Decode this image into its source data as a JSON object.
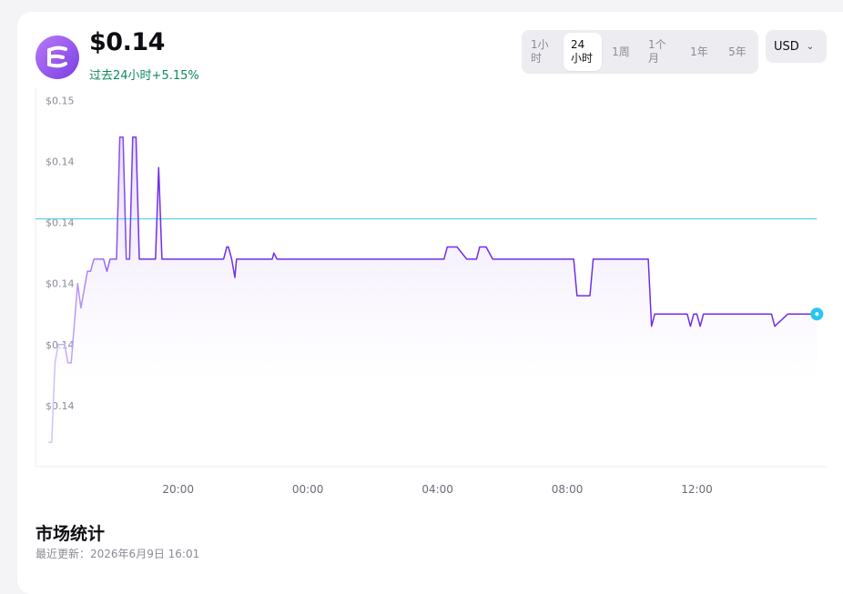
{
  "header": {
    "price": "$0.14",
    "change_period": "过去24小时",
    "change_value": "+5.15%"
  },
  "ranges": [
    {
      "label": "1小时",
      "active": false
    },
    {
      "label": "24小时",
      "active": true
    },
    {
      "label": "1周",
      "active": false
    },
    {
      "label": "1个月",
      "active": false
    },
    {
      "label": "1年",
      "active": false
    },
    {
      "label": "5年",
      "active": false
    }
  ],
  "currency": {
    "label": "USD",
    "icon": "chevron-down-icon"
  },
  "stats": {
    "title": "市场统计",
    "updated_label": "最近更新：",
    "updated_value": "2026年6月9日 16:01"
  },
  "colors": {
    "line": "#6f2fe8",
    "line_light": "#cdb8f6",
    "reference_line": "#3cc6e8",
    "fill": "#efe7fd",
    "brand": "#8b4ef0",
    "positive": "#0d8a5a"
  },
  "chart_data": {
    "type": "line",
    "x_tick_labels": [
      "20:00",
      "00:00",
      "04:00",
      "08:00",
      "12:00"
    ],
    "x_ticks_hours": [
      20,
      24,
      28,
      32,
      36
    ],
    "y_tick_labels": [
      "$0.15",
      "$0.14",
      "$0.14",
      "$0.14",
      "$0.14",
      "$0.14"
    ],
    "y_ticks_values": [
      0.1435,
      0.1425,
      0.1415,
      0.1405,
      0.1395,
      0.1385
    ],
    "ylim": [
      0.1375,
      0.1437
    ],
    "xlim": [
      15.6,
      40
    ],
    "reference_value": 0.14156,
    "last_value": 0.14156,
    "grid": false,
    "legend": "none",
    "series": [
      {
        "hours": [
          16,
          16.1,
          16.2,
          16.3,
          16.5,
          16.6,
          16.7,
          16.9,
          17.0,
          17.2,
          17.3,
          17.4,
          17.6,
          17.7,
          17.8,
          17.9,
          18.0,
          18.1,
          18.2,
          18.3,
          18.4,
          18.5,
          18.6,
          18.7,
          18.8,
          18.9,
          19.0,
          19.1,
          19.2,
          19.3,
          19.4,
          19.5,
          19.7,
          19.9,
          20.1,
          20.15,
          20.25,
          20.35,
          20.45,
          20.6,
          21.0,
          21.4,
          21.5,
          21.55,
          21.65,
          21.75,
          21.8,
          21.85,
          21.95,
          22.05,
          22.1,
          22.2,
          22.35,
          22.8,
          22.9,
          22.95,
          23.05,
          23.15,
          23.3,
          23.5,
          23.55,
          23.65,
          23.8,
          23.9,
          24.1,
          24.2,
          24.3,
          24.4,
          24.5,
          24.6,
          24.8,
          25.2,
          25.3,
          25.35,
          25.45,
          25.55,
          25.65,
          25.75,
          25.85,
          25.9,
          26.0,
          26.1,
          26.2,
          26.3,
          26.6,
          26.65,
          26.75,
          27.0,
          27.05,
          27.15,
          27.3,
          27.8,
          27.9,
          28.2,
          28.3,
          28.6,
          28.9,
          29.0,
          29.2,
          29.3,
          29.5,
          29.7,
          31.4,
          31.5,
          31.55,
          31.65,
          31.75,
          31.85,
          31.9,
          32.0,
          32.1,
          32.2,
          32.3,
          32.4,
          32.5,
          32.6,
          32.7,
          32.8,
          32.9,
          33.0,
          33.1,
          33.2,
          33.3,
          33.4,
          33.6,
          33.7,
          33.8,
          34.0,
          34.3,
          34.5,
          34.6,
          34.7,
          35.5,
          35.6,
          35.7,
          35.8,
          35.9,
          36.0,
          36.1,
          36.2,
          36.3,
          36.4,
          36.5,
          36.8,
          36.9,
          37.0,
          37.2,
          37.3,
          37.5,
          37.8,
          37.9,
          38.0,
          38.1,
          38.2,
          38.3,
          38.4,
          38.8,
          39.4,
          39.7
        ],
        "values": [
          0.1379,
          0.1379,
          0.1392,
          0.1395,
          0.1395,
          0.1392,
          0.1392,
          0.1405,
          0.1401,
          0.1407,
          0.1407,
          0.1409,
          0.1409,
          0.1409,
          0.1407,
          0.1409,
          0.1409,
          0.1409,
          0.1429,
          0.1429,
          0.1409,
          0.1409,
          0.1429,
          0.1429,
          0.1409,
          0.1409,
          0.1409,
          0.1409,
          0.1409,
          0.1409,
          0.1424,
          0.1409,
          0.1409,
          0.1409,
          0.1409,
          0.1409,
          0.1409,
          0.1409,
          0.1409,
          0.1409,
          0.1409,
          0.1409,
          0.1411,
          0.1411,
          0.1409,
          0.1406,
          0.1409,
          0.1409,
          0.1409,
          0.1409,
          0.1409,
          0.1409,
          0.1409,
          0.1409,
          0.1409,
          0.141,
          0.1409,
          0.1409,
          0.1409,
          0.1409,
          0.1409,
          0.1409,
          0.1409,
          0.1409,
          0.1409,
          0.1409,
          0.1409,
          0.1409,
          0.1409,
          0.1409,
          0.1409,
          0.1409,
          0.1409,
          0.1409,
          0.1409,
          0.1409,
          0.1409,
          0.1409,
          0.1409,
          0.1409,
          0.1409,
          0.1409,
          0.1409,
          0.1409,
          0.1409,
          0.1409,
          0.1409,
          0.1409,
          0.1409,
          0.1409,
          0.1409,
          0.1409,
          0.1409,
          0.1409,
          0.1411,
          0.1411,
          0.1409,
          0.1409,
          0.1409,
          0.1411,
          0.1411,
          0.1409,
          0.1409,
          0.1409,
          0.1409,
          0.1409,
          0.1409,
          0.1409,
          0.1409,
          0.1409,
          0.1409,
          0.1409,
          0.1403,
          0.1403,
          0.1403,
          0.1403,
          0.1403,
          0.1409,
          0.1409,
          0.1409,
          0.1409,
          0.1409,
          0.1409,
          0.1409,
          0.1409,
          0.1409,
          0.1409,
          0.1409,
          0.1409,
          0.1409,
          0.1398,
          0.14,
          0.14,
          0.14,
          0.14,
          0.1398,
          0.14,
          0.14,
          0.1398,
          0.14,
          0.14,
          0.14,
          0.14,
          0.14,
          0.14,
          0.14,
          0.14,
          0.14,
          0.14,
          0.14,
          0.14,
          0.14,
          0.14,
          0.14,
          0.14,
          0.1398,
          0.14,
          0.14,
          0.14
        ]
      }
    ]
  }
}
